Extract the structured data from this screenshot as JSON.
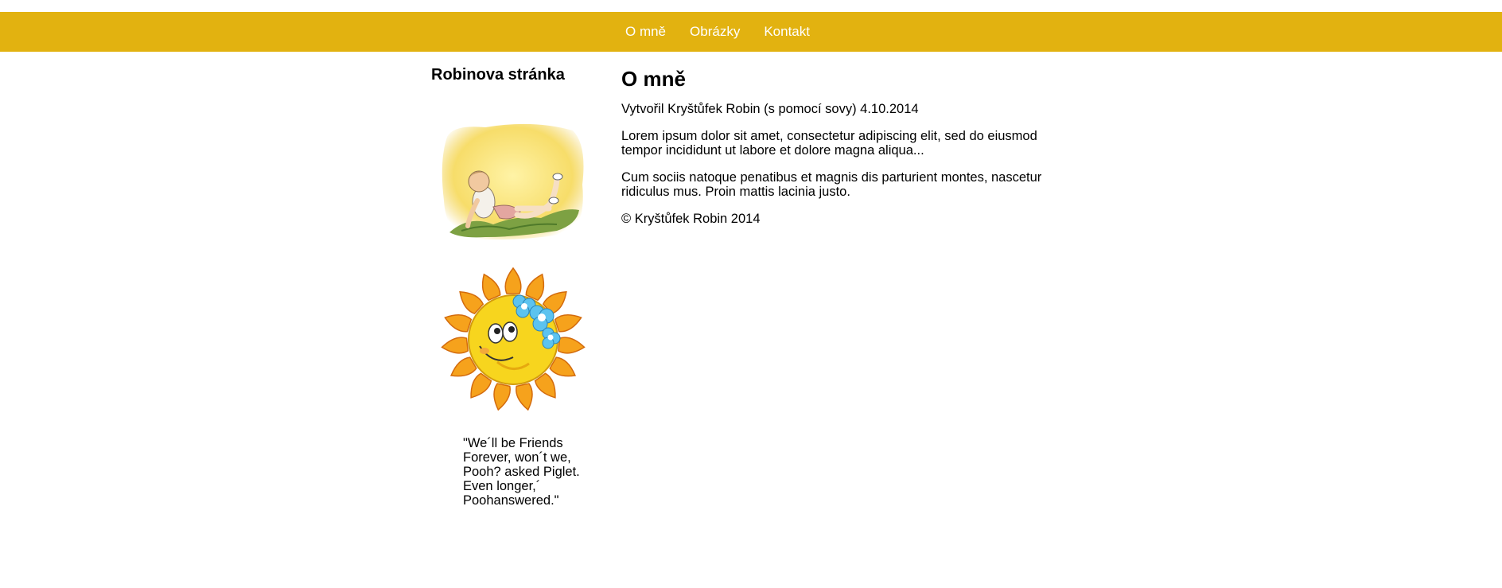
{
  "nav": {
    "items": [
      {
        "label": "O mně"
      },
      {
        "label": "Obrázky"
      },
      {
        "label": "Kontakt"
      }
    ]
  },
  "sidebar": {
    "title": "Robinova stránka",
    "quote": "\"We´ll be Friends Forever, won´t we, Pooh? asked Piglet. Even longer,´ Poohanswered.\""
  },
  "main": {
    "heading": "O mně",
    "created": "Vytvořil Kryštůfek Robin (s pomocí sovy) 4.10.2014",
    "paragraph1": "Lorem ipsum dolor sit amet, consectetur adipiscing elit, sed do eiusmod tempor incididunt ut labore et dolore magna aliqua...",
    "paragraph2": "Cum sociis natoque penatibus et magnis dis parturient montes, nascetur ridiculus mus. Proin mattis lacinia justo.",
    "copyright": "© Kryštůfek Robin 2014"
  },
  "colors": {
    "nav_background": "#e2b210",
    "nav_text": "#ffffff"
  },
  "images": {
    "picture1": "boy-lying-in-grass-illustration",
    "picture2": "smiling-sun-with-flowers-illustration"
  }
}
